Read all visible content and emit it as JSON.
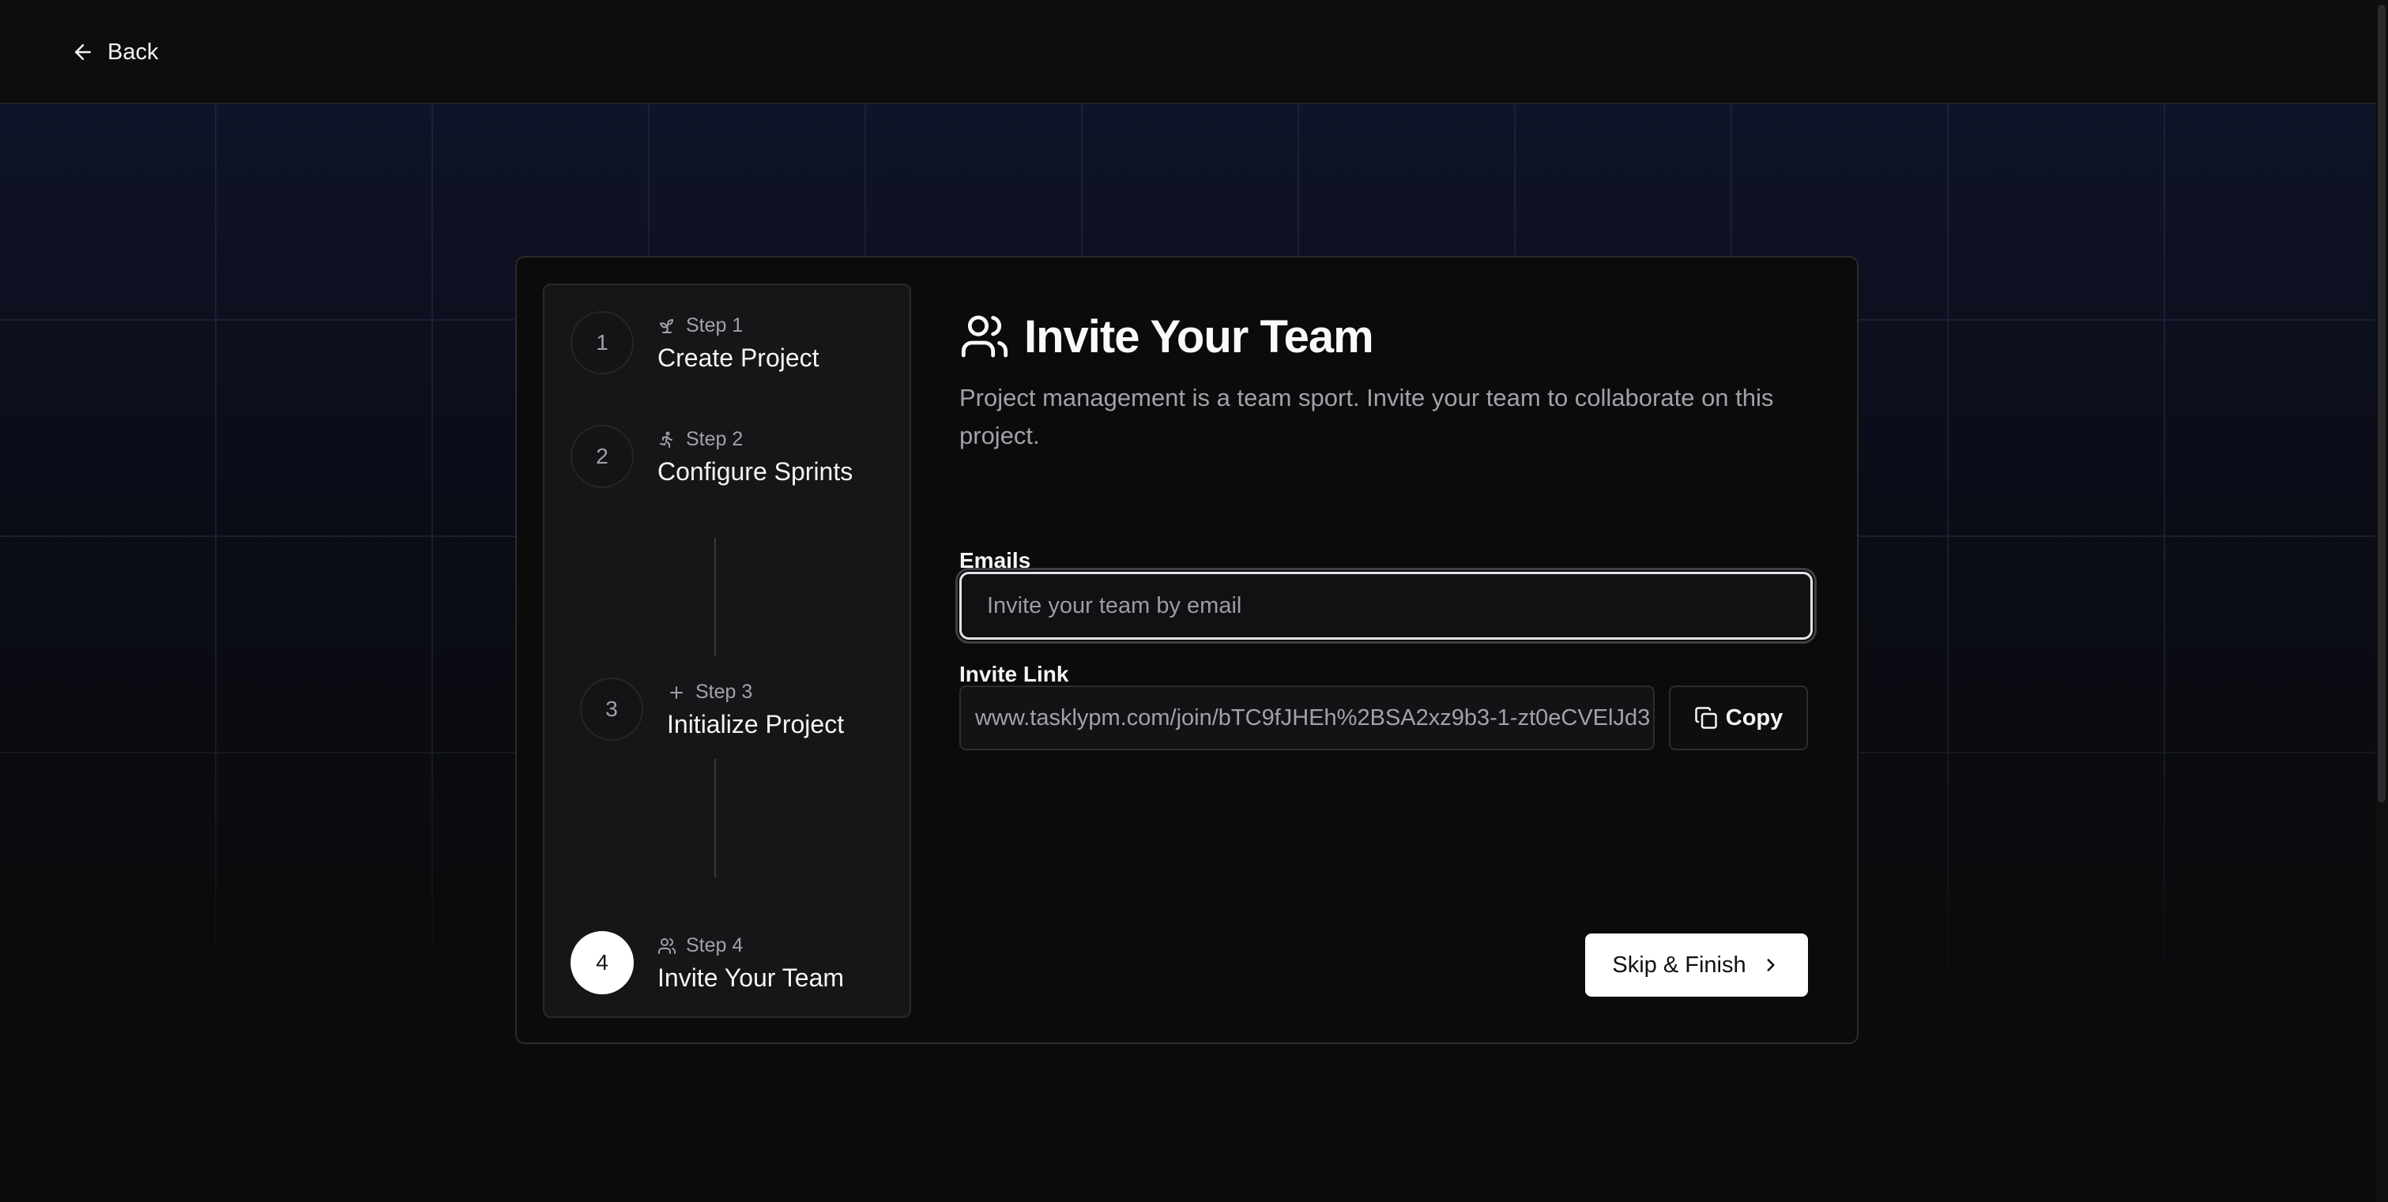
{
  "topbar": {
    "back_label": "Back"
  },
  "steps": [
    {
      "number": "1",
      "step_label": "Step 1",
      "title": "Create Project",
      "icon": "sprout-icon",
      "active": false
    },
    {
      "number": "2",
      "step_label": "Step 2",
      "title": "Configure Sprints",
      "icon": "running-person-icon",
      "active": false
    },
    {
      "number": "3",
      "step_label": "Step 3",
      "title": "Initialize Project",
      "icon": "plus-icon",
      "active": false
    },
    {
      "number": "4",
      "step_label": "Step 4",
      "title": "Invite Your Team",
      "icon": "users-icon",
      "active": true
    }
  ],
  "main": {
    "title": "Invite Your Team",
    "title_icon": "users-icon",
    "description": "Project management is a team sport. Invite your team to collaborate on this project.",
    "emails_label": "Emails",
    "emails_placeholder": "Invite your team by email",
    "emails_value": "",
    "invite_link_label": "Invite Link",
    "invite_link_value": "www.tasklypm.com/join/bTC9fJHEh%2BSA2xz9b3-1-zt0eCVElJd3",
    "copy_label": "Copy",
    "finish_label": "Skip & Finish"
  },
  "colors": {
    "background": "#0b0b0d",
    "panel": "#161618",
    "accent_button": "#ffffff",
    "muted_text": "#a1a1aa"
  }
}
